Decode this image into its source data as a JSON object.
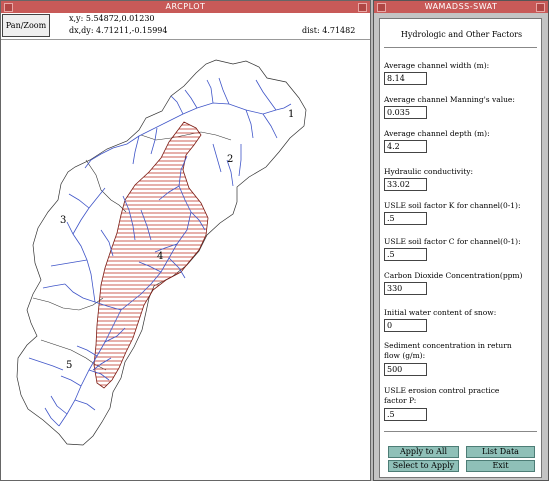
{
  "arcplot": {
    "title": "ARCPLOT",
    "pan_zoom_label": "Pan/Zoom",
    "xy_label": "x,y: 5.54872,0.01230",
    "dxdy_label": "dx,dy: 4.71211,-0.15994",
    "dist_label": "dist: 4.71482",
    "subbasin_labels": [
      "1",
      "2",
      "3",
      "4",
      "5"
    ]
  },
  "wamadss": {
    "title": "WAMADSS-SWAT",
    "heading": "Hydrologic and Other Factors",
    "fields": [
      {
        "label": "Average channel width (m):",
        "value": "8.14"
      },
      {
        "label": "Average channel Manning's value:",
        "value": "0.035"
      },
      {
        "label": "Average channel depth (m):",
        "value": "4.2"
      },
      {
        "label": "Hydraulic conductivity:",
        "value": "33.02"
      },
      {
        "label": "USLE soil factor K for channel(0-1):",
        "value": ".5"
      },
      {
        "label": "USLE soil factor C for channel(0-1):",
        "value": ".5"
      },
      {
        "label": "Carbon Dioxide Concentration(ppm)",
        "value": "330"
      },
      {
        "label": "Initial water content of snow:",
        "value": "0"
      },
      {
        "label": "Sediment concentration in return\nflow (g/m):",
        "value": "500"
      },
      {
        "label": "USLE erosion control practice\nfactor P:",
        "value": ".5"
      }
    ],
    "buttons": {
      "apply_all": "Apply to All",
      "list_data": "List Data",
      "select_apply": "Select to Apply",
      "exit": "Exit"
    }
  },
  "colors": {
    "titlebar": "#c85a58",
    "hatch": "#c0392b",
    "stream": "#3f55c8",
    "button": "#8fc0b8"
  }
}
